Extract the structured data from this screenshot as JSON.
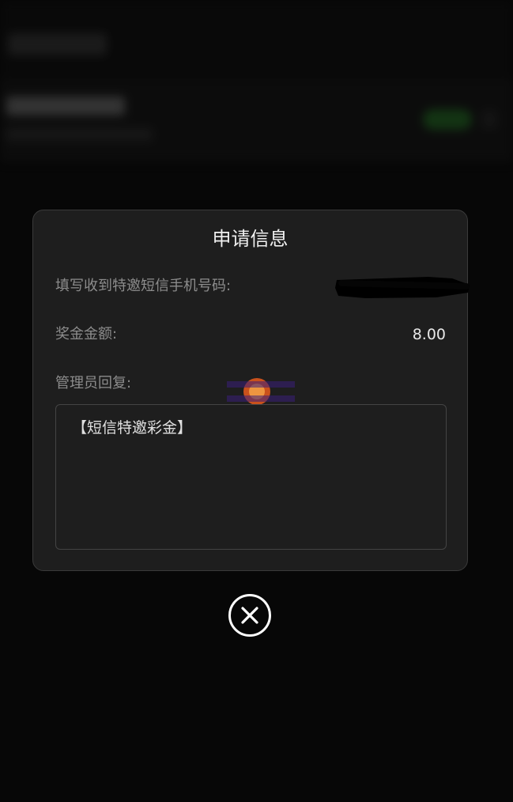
{
  "modal": {
    "title": "申请信息",
    "phone_label": "填写收到特邀短信手机号码:",
    "amount_label": "奖金金额:",
    "amount_value": "8.00",
    "reply_label": "管理员回复:",
    "reply_text": "【短信特邀彩金】"
  },
  "icons": {
    "close": "close-circle-icon",
    "watermark": "watermark-logo-icon"
  },
  "colors": {
    "background": "#0b0b0b",
    "modal_bg": "#1e1e1e",
    "label": "#8c8c8c",
    "text": "#e8e8e8"
  }
}
